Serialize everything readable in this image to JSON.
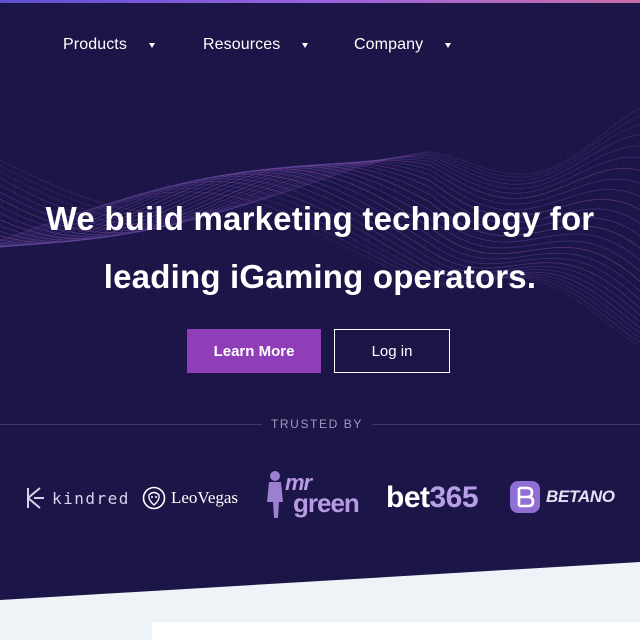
{
  "nav": {
    "items": [
      {
        "label": "Products"
      },
      {
        "label": "Resources"
      },
      {
        "label": "Company"
      }
    ]
  },
  "hero": {
    "headline_line1": "We build marketing technology for",
    "headline_line2": "leading iGaming operators.",
    "primary_button": "Learn More",
    "secondary_button": "Log in"
  },
  "trusted": {
    "label": "TRUSTED BY",
    "logos": [
      {
        "name": "kindred",
        "text": "kindred",
        "icon": "kindred-icon"
      },
      {
        "name": "leovegas",
        "text": "LeoVegas",
        "icon": "lion-emblem-icon"
      },
      {
        "name": "mrgreen",
        "text_top": "mr",
        "text_bottom": "green",
        "icon": "mr-green-figure-icon"
      },
      {
        "name": "bet365",
        "text_a": "bet",
        "text_b": "365"
      },
      {
        "name": "betano",
        "text": "BETANO",
        "icon": "betano-b-icon"
      }
    ]
  },
  "colors": {
    "hero_bg": "#1c1547",
    "primary": "#8f3eb8",
    "page_bg": "#eef3f7",
    "wave_violet": "#7a5fd0",
    "wave_magenta": "#c067c8"
  }
}
